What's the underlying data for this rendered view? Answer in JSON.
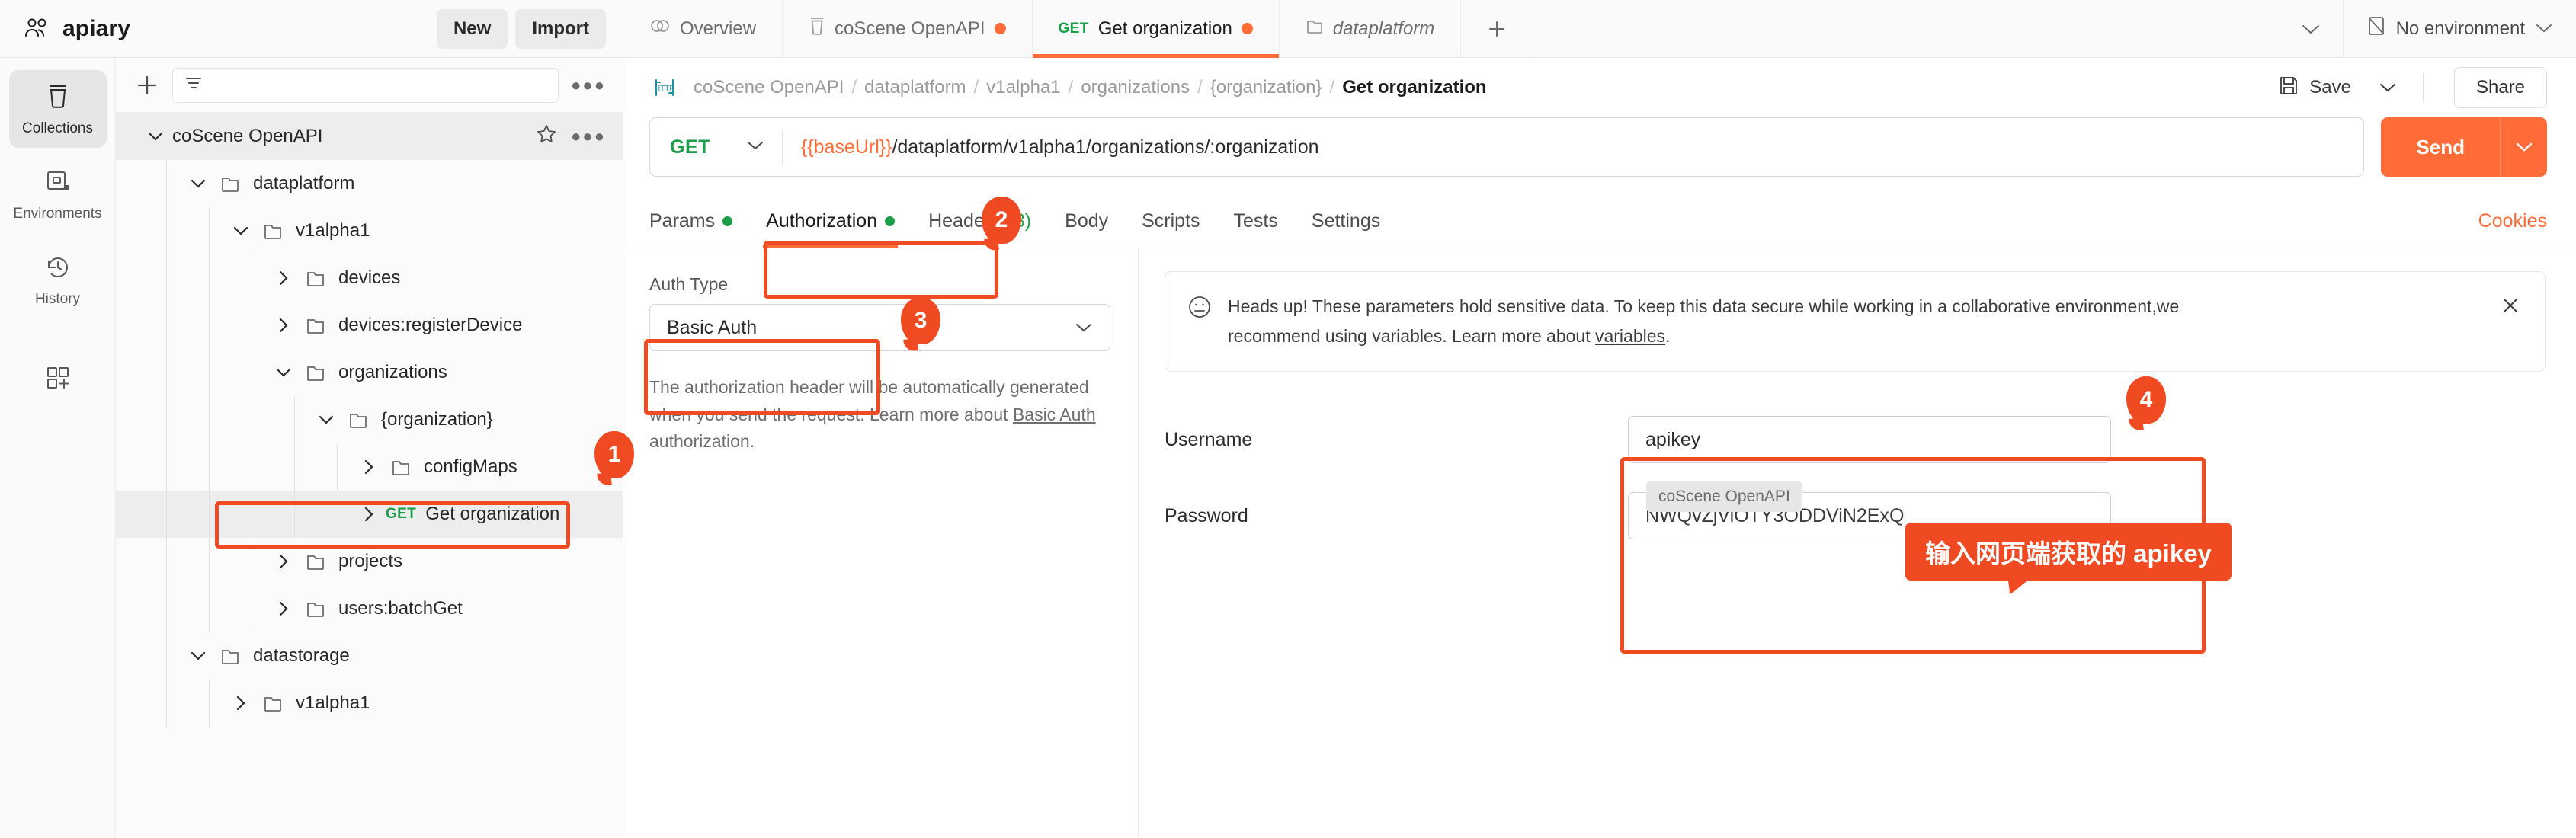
{
  "brand": {
    "name": "apiary",
    "icon": "users-icon",
    "new_label": "New",
    "import_label": "Import"
  },
  "tabs": [
    {
      "label": "Overview",
      "icon": "overview-icon",
      "method": "",
      "unsaved": false,
      "active": false,
      "italic": false
    },
    {
      "label": "coScene OpenAPI",
      "icon": "collection-icon",
      "method": "",
      "unsaved": true,
      "active": false,
      "italic": false
    },
    {
      "label": "Get organization",
      "icon": "",
      "method": "GET",
      "unsaved": true,
      "active": true,
      "italic": false
    },
    {
      "label": "dataplatform",
      "icon": "folder-icon",
      "method": "",
      "unsaved": false,
      "active": false,
      "italic": true
    }
  ],
  "tab_add_label": "+",
  "environment": {
    "label": "No environment",
    "icon": "environment-icon"
  },
  "rail": [
    {
      "label": "Collections",
      "icon": "collection-icon",
      "active": true
    },
    {
      "label": "Environments",
      "icon": "environment-icon",
      "active": false
    },
    {
      "label": "History",
      "icon": "history-icon",
      "active": false
    },
    {
      "label": "",
      "icon": "new-module-icon",
      "active": false
    }
  ],
  "tree_toolbar": {
    "plus": "plus-icon",
    "filter_placeholder": "",
    "more": "●●●"
  },
  "tree": [
    {
      "label": "coScene OpenAPI",
      "depth": 0,
      "caret": "down",
      "icon": "",
      "method": "",
      "selected": true,
      "highlight": false,
      "actions": true
    },
    {
      "label": "dataplatform",
      "depth": 1,
      "caret": "down",
      "icon": "folder-icon",
      "method": "",
      "selected": false,
      "highlight": false,
      "actions": false
    },
    {
      "label": "v1alpha1",
      "depth": 2,
      "caret": "down",
      "icon": "folder-icon",
      "method": "",
      "selected": false,
      "highlight": false,
      "actions": false
    },
    {
      "label": "devices",
      "depth": 3,
      "caret": "right",
      "icon": "folder-icon",
      "method": "",
      "selected": false,
      "highlight": false,
      "actions": false
    },
    {
      "label": "devices:registerDevice",
      "depth": 3,
      "caret": "right",
      "icon": "folder-icon",
      "method": "",
      "selected": false,
      "highlight": false,
      "actions": false
    },
    {
      "label": "organizations",
      "depth": 3,
      "caret": "down",
      "icon": "folder-icon",
      "method": "",
      "selected": false,
      "highlight": false,
      "actions": false
    },
    {
      "label": "{organization}",
      "depth": 4,
      "caret": "down",
      "icon": "folder-icon",
      "method": "",
      "selected": false,
      "highlight": false,
      "actions": false
    },
    {
      "label": "configMaps",
      "depth": 5,
      "caret": "right",
      "icon": "folder-icon",
      "method": "",
      "selected": false,
      "highlight": false,
      "actions": false
    },
    {
      "label": "Get organization",
      "depth": 5,
      "caret": "right",
      "icon": "",
      "method": "GET",
      "selected": false,
      "highlight": true,
      "actions": false
    },
    {
      "label": "projects",
      "depth": 3,
      "caret": "right",
      "icon": "folder-icon",
      "method": "",
      "selected": false,
      "highlight": false,
      "actions": false
    },
    {
      "label": "users:batchGet",
      "depth": 3,
      "caret": "right",
      "icon": "folder-icon",
      "method": "",
      "selected": false,
      "highlight": false,
      "actions": false
    },
    {
      "label": "datastorage",
      "depth": 1,
      "caret": "down",
      "icon": "folder-icon",
      "method": "",
      "selected": false,
      "highlight": false,
      "actions": false
    },
    {
      "label": "v1alpha1",
      "depth": 2,
      "caret": "right",
      "icon": "folder-icon",
      "method": "",
      "selected": false,
      "highlight": false,
      "actions": false
    }
  ],
  "breadcrumb": {
    "http_badge": "HTTP",
    "items": [
      "coScene OpenAPI",
      "dataplatform",
      "v1alpha1",
      "organizations",
      "{organization}"
    ],
    "current": "Get organization",
    "separator": "/"
  },
  "actions": {
    "save_label": "Save",
    "save_icon": "save-icon",
    "share_label": "Share",
    "caret_icon": "chevron-down-icon"
  },
  "request": {
    "method": "GET",
    "url_variable": "{{baseUrl}}",
    "url_path": "/dataplatform/v1alpha1/organizations/:organization",
    "send_label": "Send"
  },
  "subtabs": [
    {
      "label": "Params",
      "dot": true,
      "count": "",
      "active": false
    },
    {
      "label": "Authorization",
      "dot": true,
      "count": "",
      "active": true
    },
    {
      "label": "Headers",
      "dot": false,
      "count": "(8)",
      "active": false
    },
    {
      "label": "Body",
      "dot": false,
      "count": "",
      "active": false
    },
    {
      "label": "Scripts",
      "dot": false,
      "count": "",
      "active": false
    },
    {
      "label": "Tests",
      "dot": false,
      "count": "",
      "active": false
    },
    {
      "label": "Settings",
      "dot": false,
      "count": "",
      "active": false
    }
  ],
  "cookies_label": "Cookies",
  "auth": {
    "type_label": "Auth Type",
    "type_value": "Basic Auth",
    "help_text_1": "The authorization header will be automatically generated when you send the request. Learn more about ",
    "help_link": "Basic Auth",
    "help_text_2": " authorization."
  },
  "notice": {
    "icon": "info-icon",
    "line1": "Heads up! These parameters hold sensitive data. To keep this data secure while working in a collaborative environment,we",
    "line2_prefix": "recommend using variables. Learn more about ",
    "line2_link": "variables",
    "line2_suffix": ".",
    "close_icon": "close-icon"
  },
  "credentials": {
    "username_label": "Username",
    "username_value": "apikey",
    "password_label": "Password",
    "password_value": "NWQvZjViOTY3ODDViN2ExQ",
    "tooltip": "coScene OpenAPI"
  },
  "annotations": {
    "badge1": "1",
    "badge2": "2",
    "badge3": "3",
    "badge4": "4",
    "callout": "输入网页端获取的 apikey"
  },
  "colors": {
    "accent": "#ff6c37",
    "annotation": "#f04a23",
    "method_get": "#1a9e47",
    "panel_bg": "#fafafa"
  }
}
